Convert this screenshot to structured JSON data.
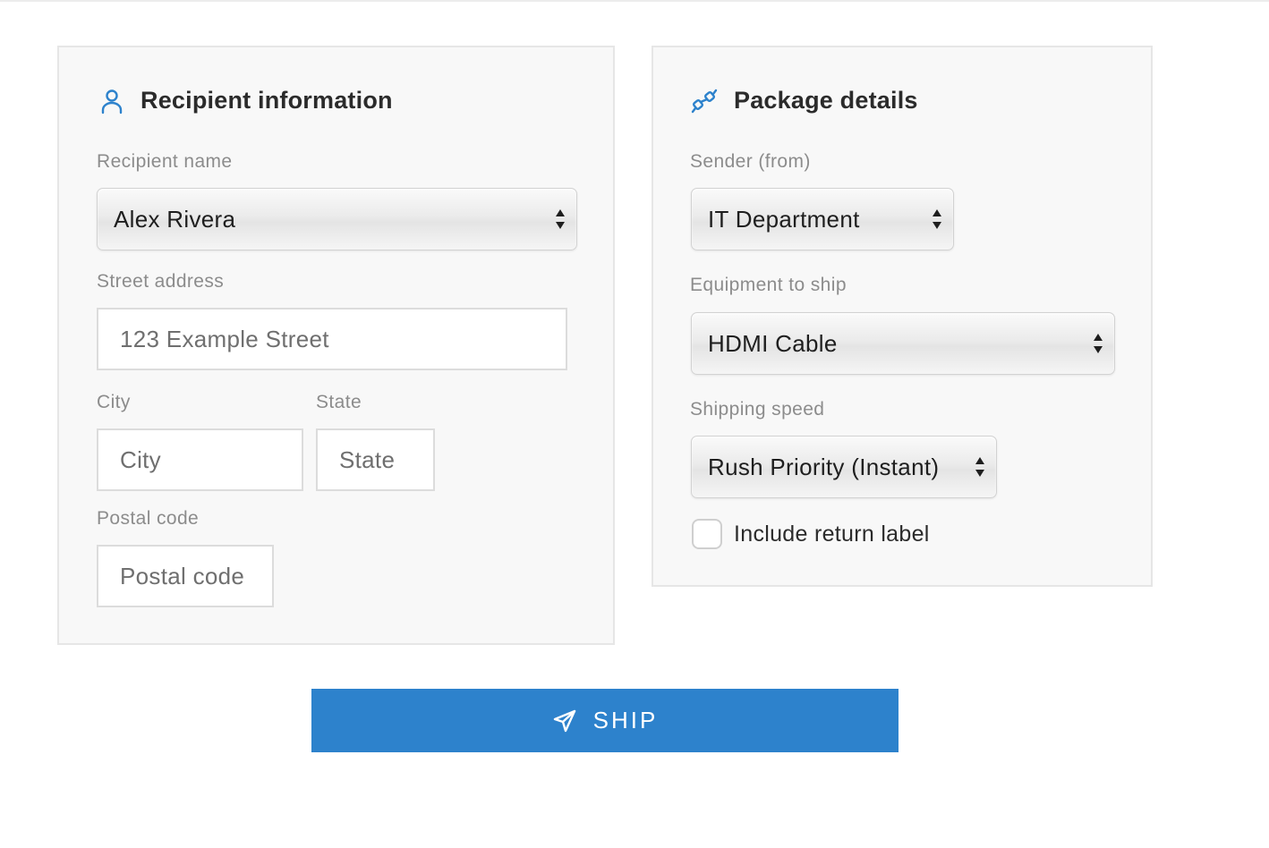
{
  "colors": {
    "accent": "#2d82cc",
    "panel_bg": "#f8f8f8",
    "label": "#8c8c8c"
  },
  "recipient": {
    "title": "Recipient information",
    "icon": "person-icon",
    "name_label": "Recipient name",
    "name_value": "Alex Rivera",
    "street_label": "Street address",
    "street_placeholder": "123 Example Street",
    "city_label": "City",
    "city_placeholder": "City",
    "state_label": "State",
    "state_placeholder": "State",
    "postal_label": "Postal code",
    "postal_placeholder": "Postal code"
  },
  "package": {
    "title": "Package details",
    "icon": "cable-plug-icon",
    "sender_label": "Sender (from)",
    "sender_value": "IT Department",
    "equipment_label": "Equipment to ship",
    "equipment_value": "HDMI Cable",
    "speed_label": "Shipping speed",
    "speed_value": "Rush Priority (Instant)",
    "return_label": "Include return label",
    "return_checked": false
  },
  "actions": {
    "ship_label": "SHIP",
    "ship_icon": "paper-plane-icon"
  }
}
